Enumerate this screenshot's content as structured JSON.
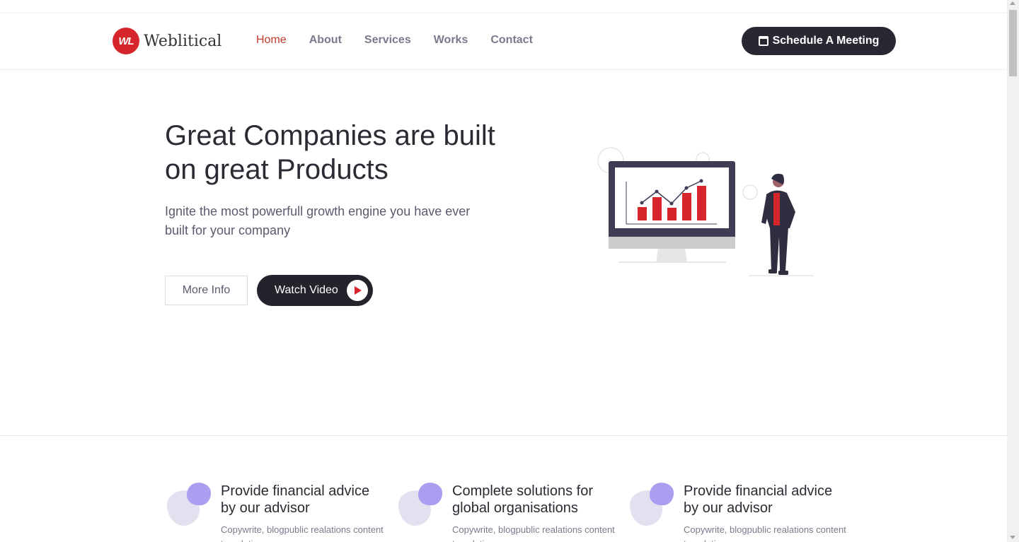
{
  "brand": {
    "logo_mark": "WL",
    "name": "Weblitical",
    "accent": "#d6262b"
  },
  "nav": {
    "items": [
      {
        "label": "Home",
        "active": true
      },
      {
        "label": "About",
        "active": false
      },
      {
        "label": "Services",
        "active": false
      },
      {
        "label": "Works",
        "active": false
      },
      {
        "label": "Contact",
        "active": false
      }
    ],
    "cta_label": "Schedule A Meeting",
    "cta_icon": "calendar-icon"
  },
  "hero": {
    "title": "Great Companies are built on great Products",
    "subtitle": "Ignite the most powerfull growth engine you have ever built for your company",
    "more_label": "More Info",
    "video_label": "Watch Video",
    "video_icon": "play-icon"
  },
  "features": [
    {
      "title": "Provide financial advice by our advisor",
      "desc": "Copywrite, blogpublic realations content translation"
    },
    {
      "title": "Complete solutions for global organisations",
      "desc": "Copywrite, blogpublic realations content translation"
    },
    {
      "title": "Provide financial advice by our advisor",
      "desc": "Copywrite, blogpublic realations content translation"
    }
  ],
  "colors": {
    "dark": "#2a2733",
    "blob_light": "#e3e1ef",
    "blob_accent": "#ab9ef0",
    "chart_red": "#d6262b"
  }
}
